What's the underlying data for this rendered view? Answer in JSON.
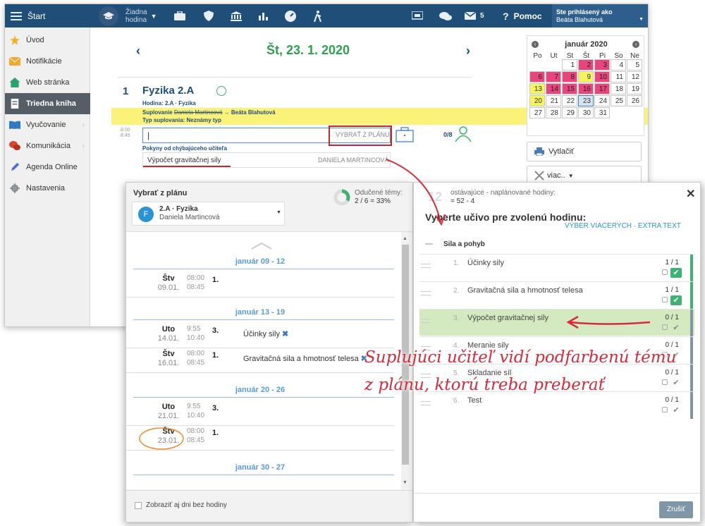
{
  "topbar": {
    "start": "Štart",
    "lesson_l1": "Žiadna",
    "lesson_l2": "hodina",
    "msg_count": "5",
    "help": "Pomoc",
    "logged_l1": "Ste prihlásený ako",
    "logged_l2": "Beáta Blahutová"
  },
  "sidebar": {
    "items": [
      {
        "label": "Úvod"
      },
      {
        "label": "Notifikácie"
      },
      {
        "label": "Web stránka"
      },
      {
        "label": "Triedna kniha"
      },
      {
        "label": "Vyučovanie"
      },
      {
        "label": "Komunikácia"
      },
      {
        "label": "Agenda Online"
      },
      {
        "label": "Nastavenia"
      }
    ]
  },
  "header": {
    "date": "Št, 23. 1. 2020"
  },
  "lesson": {
    "number": "1",
    "title": "Fyzika 2.A",
    "subinfo": "Hodina: 2.A · Fyzika",
    "subst_label": "Suplovanie",
    "subst_from": "Daniela Martincová",
    "subst_to": "→ Beáta Blahutová",
    "subst_type": "Typ suplovania: Neznámy typ",
    "time1": "8:00",
    "time2": "8:45",
    "pick_button": "VYBRAŤ Z PLÁNU",
    "count": "0/8",
    "instr_label": "Pokyny od chýbajúceho učiteľa",
    "instr_text": "Výpočet gravitačnej sily",
    "instr_teacher": "DANIELA MARTINCOVÁ"
  },
  "calendar": {
    "month": "január 2020",
    "headers": [
      "Po",
      "Ut",
      "St",
      "Št",
      "Pi",
      "So",
      "Ne"
    ],
    "rows": [
      [
        "",
        "",
        "1",
        "2",
        "3",
        "4",
        "5"
      ],
      [
        "6",
        "7",
        "8",
        "9",
        "10",
        "11",
        "12"
      ],
      [
        "13",
        "14",
        "15",
        "16",
        "17",
        "18",
        "19"
      ],
      [
        "20",
        "21",
        "22",
        "23",
        "24",
        "25",
        "26"
      ],
      [
        "27",
        "28",
        "29",
        "30",
        "31",
        "",
        ""
      ]
    ],
    "pink_days": [
      "2",
      "3",
      "6",
      "7",
      "8",
      "10",
      "14",
      "15",
      "16",
      "17"
    ],
    "yellow_days": [
      "9",
      "13",
      "20"
    ],
    "today": "23"
  },
  "side_buttons": {
    "print": "Vytlačiť",
    "more": "viac.."
  },
  "popup": {
    "title": "Vybrať z plánu",
    "taught_label": "Odučené témy:",
    "taught_value": "2 / 6 = 33%",
    "class_name": "2.A · Fyzika",
    "teacher": "Daniela Martincová",
    "avatar_letter": "F",
    "remaining_label": "ostávajúce - naplánované hodiny:",
    "remaining_value": "= 52 - 4",
    "choose_heading": "Vyberte učivo pre zvolenú hodinu:",
    "multi_select": "VÝBER VIACERÝCH · EXTRA TEXT",
    "section": "Sila a pohyb",
    "show_all": "Zobraziť aj dni bez hodiny",
    "cancel": "Zrušiť",
    "weeks": [
      {
        "label": "január 09 - 12"
      },
      {
        "label": "január 13 - 19"
      },
      {
        "label": "január 20 - 26"
      },
      {
        "label": "január 30 - 27"
      }
    ],
    "lessons": [
      {
        "day": "Štv",
        "date": "09.01.",
        "t1": "08:00",
        "t2": "08:45",
        "num": "1.",
        "topic": ""
      },
      {
        "day": "Uto",
        "date": "14.01.",
        "t1": "9:55",
        "t2": "10:40",
        "num": "3.",
        "topic": "Účinky sily"
      },
      {
        "day": "Štv",
        "date": "16.01.",
        "t1": "08:00",
        "t2": "08:45",
        "num": "1.",
        "topic": "Gravitačná sila a hmotnosť telesa"
      },
      {
        "day": "Uto",
        "date": "21.01.",
        "t1": "9:55",
        "t2": "10:40",
        "num": "3.",
        "topic": ""
      },
      {
        "day": "Štv",
        "date": "23.01.",
        "t1": "08:00",
        "t2": "08:45",
        "num": "1.",
        "topic": ""
      }
    ],
    "topics": [
      {
        "no": "1.",
        "name": "Účinky sily",
        "count": "1 / 1",
        "done": true
      },
      {
        "no": "2.",
        "name": "Gravitačná sila a hmotnosť telesa",
        "count": "1 / 1",
        "done": true
      },
      {
        "no": "3.",
        "name": "Výpočet gravitačnej sily",
        "count": "0 / 1",
        "done": false
      },
      {
        "no": "4.",
        "name": "Meranie sily",
        "count": "0 / 1",
        "done": false
      },
      {
        "no": "5.",
        "name": "Skladanie síl",
        "count": "0 / 1",
        "done": false
      },
      {
        "no": "6.",
        "name": "Test",
        "count": "0 / 1",
        "done": false
      }
    ],
    "ghost_number": "12"
  },
  "annotation": {
    "line1": "Suplujúci učiteľ vidí podfarbenú tému",
    "line2": "z plánu, ktorú treba preberať"
  },
  "colors": {
    "topbar": "#1f4e78",
    "accent_green": "#3cb371",
    "annotation_red": "#d42a3a",
    "highlight_yellow": "#f7f35c"
  }
}
